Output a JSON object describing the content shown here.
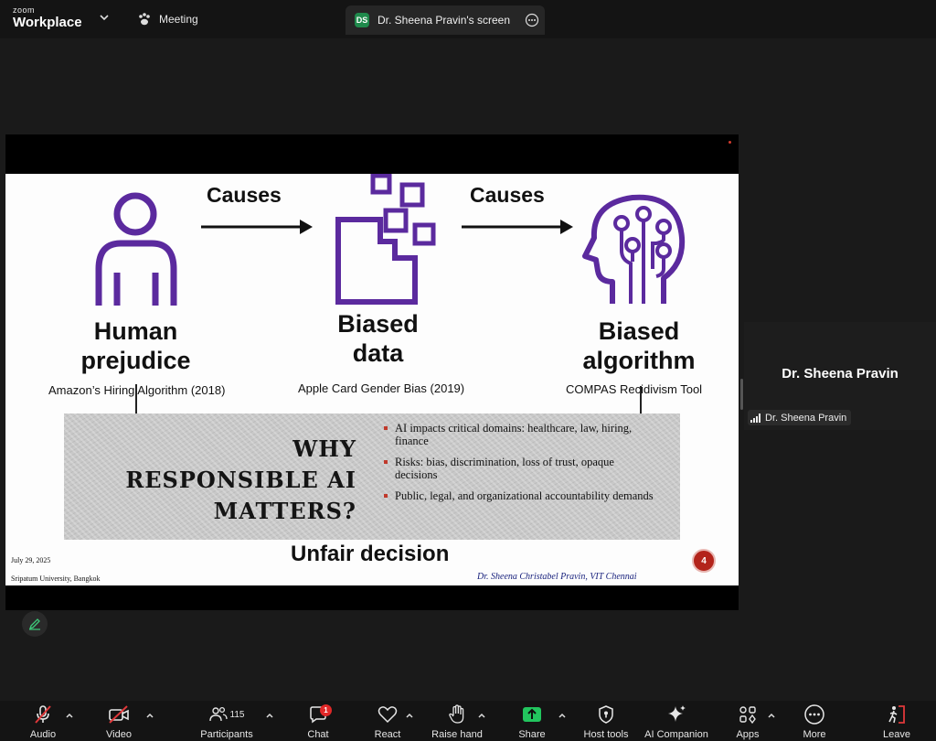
{
  "app": {
    "logo_small": "zoom",
    "logo_big": "Workplace"
  },
  "tabs": {
    "meeting_label": "Meeting",
    "screen_label": "Dr. Sheena Pravin's screen",
    "screen_initials": "DS"
  },
  "slide": {
    "col1": {
      "heading_line1": "Human",
      "heading_line2": "prejudice",
      "sub": "Amazon’s Hiring Algorithm (2018)"
    },
    "col2": {
      "heading_line1": "Biased",
      "heading_line2": "data",
      "sub": "Apple Card Gender Bias (2019)"
    },
    "col3": {
      "heading_line1": "Biased",
      "heading_line2": "algorithm",
      "sub": "COMPAS Recidivism Tool"
    },
    "causes1": "Causes",
    "causes2": "Causes",
    "banner_title_line1": "WHY RESPONSIBLE AI",
    "banner_title_line2": "MATTERS?",
    "bullets": [
      "AI impacts critical domains: healthcare, law, hiring, finance",
      "Risks: bias, discrimination, loss of trust, opaque decisions",
      "Public, legal, and organizational accountability demands"
    ],
    "bottom_text": "Unfair decision",
    "footer_date": "July 29, 2025",
    "footer_university": "Sripatum University, Bangkok",
    "footer_author": "Dr. Sheena Christabel Pravin, VIT Chennai",
    "page_number": "4",
    "accent_color": "#5b2a9e"
  },
  "participant_tile": {
    "display_name": "Dr. Sheena Pravin",
    "label": "Dr. Sheena Pravin"
  },
  "toolbar": {
    "audio": "Audio",
    "video": "Video",
    "participants": "Participants",
    "participants_count": "115",
    "chat": "Chat",
    "chat_badge": "1",
    "react": "React",
    "raise_hand": "Raise hand",
    "share": "Share",
    "host_tools": "Host tools",
    "ai_companion": "AI Companion",
    "apps": "Apps",
    "more": "More",
    "leave": "Leave"
  }
}
